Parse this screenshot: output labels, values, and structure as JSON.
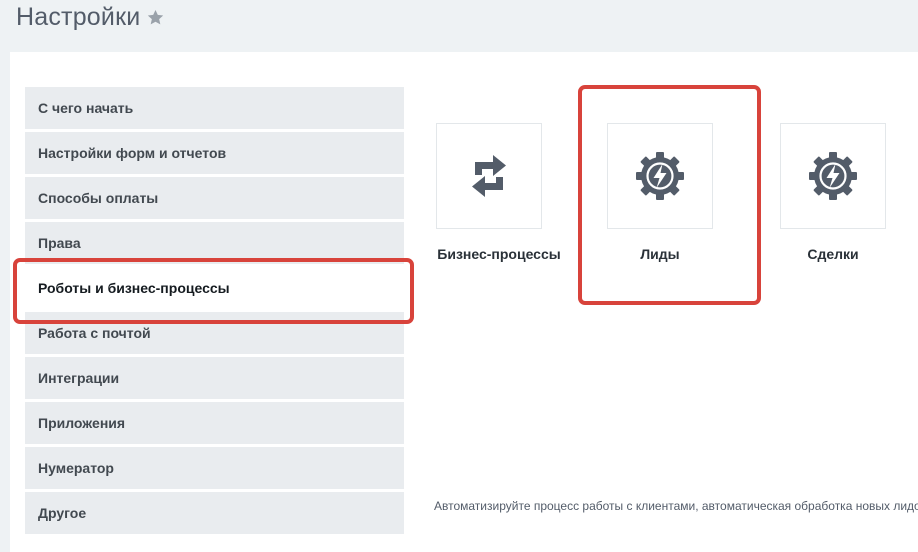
{
  "page": {
    "title": "Настройки",
    "favorite_icon": "star-icon"
  },
  "sidebar": {
    "items": [
      {
        "label": "С чего начать"
      },
      {
        "label": "Настройки форм и отчетов"
      },
      {
        "label": "Способы оплаты"
      },
      {
        "label": "Права"
      },
      {
        "label": "Роботы и бизнес-процессы",
        "active": true
      },
      {
        "label": "Работа с почтой"
      },
      {
        "label": "Интеграции"
      },
      {
        "label": "Приложения"
      },
      {
        "label": "Нумератор"
      },
      {
        "label": "Другое"
      }
    ]
  },
  "tiles": [
    {
      "label": "Бизнес-процессы",
      "icon": "refresh-icon"
    },
    {
      "label": "Лиды",
      "icon": "robot-gear-icon",
      "highlighted": true
    },
    {
      "label": "Сделки",
      "icon": "robot-gear-icon"
    }
  ],
  "description": {
    "text": "Автоматизируйте процесс работы с клиентами, автоматическая обработка новых лидов"
  },
  "colors": {
    "accent_highlight": "#d8433b",
    "icon": "#535c69",
    "background": "#eef2f4",
    "sidebar_item": "#e9ecef"
  }
}
